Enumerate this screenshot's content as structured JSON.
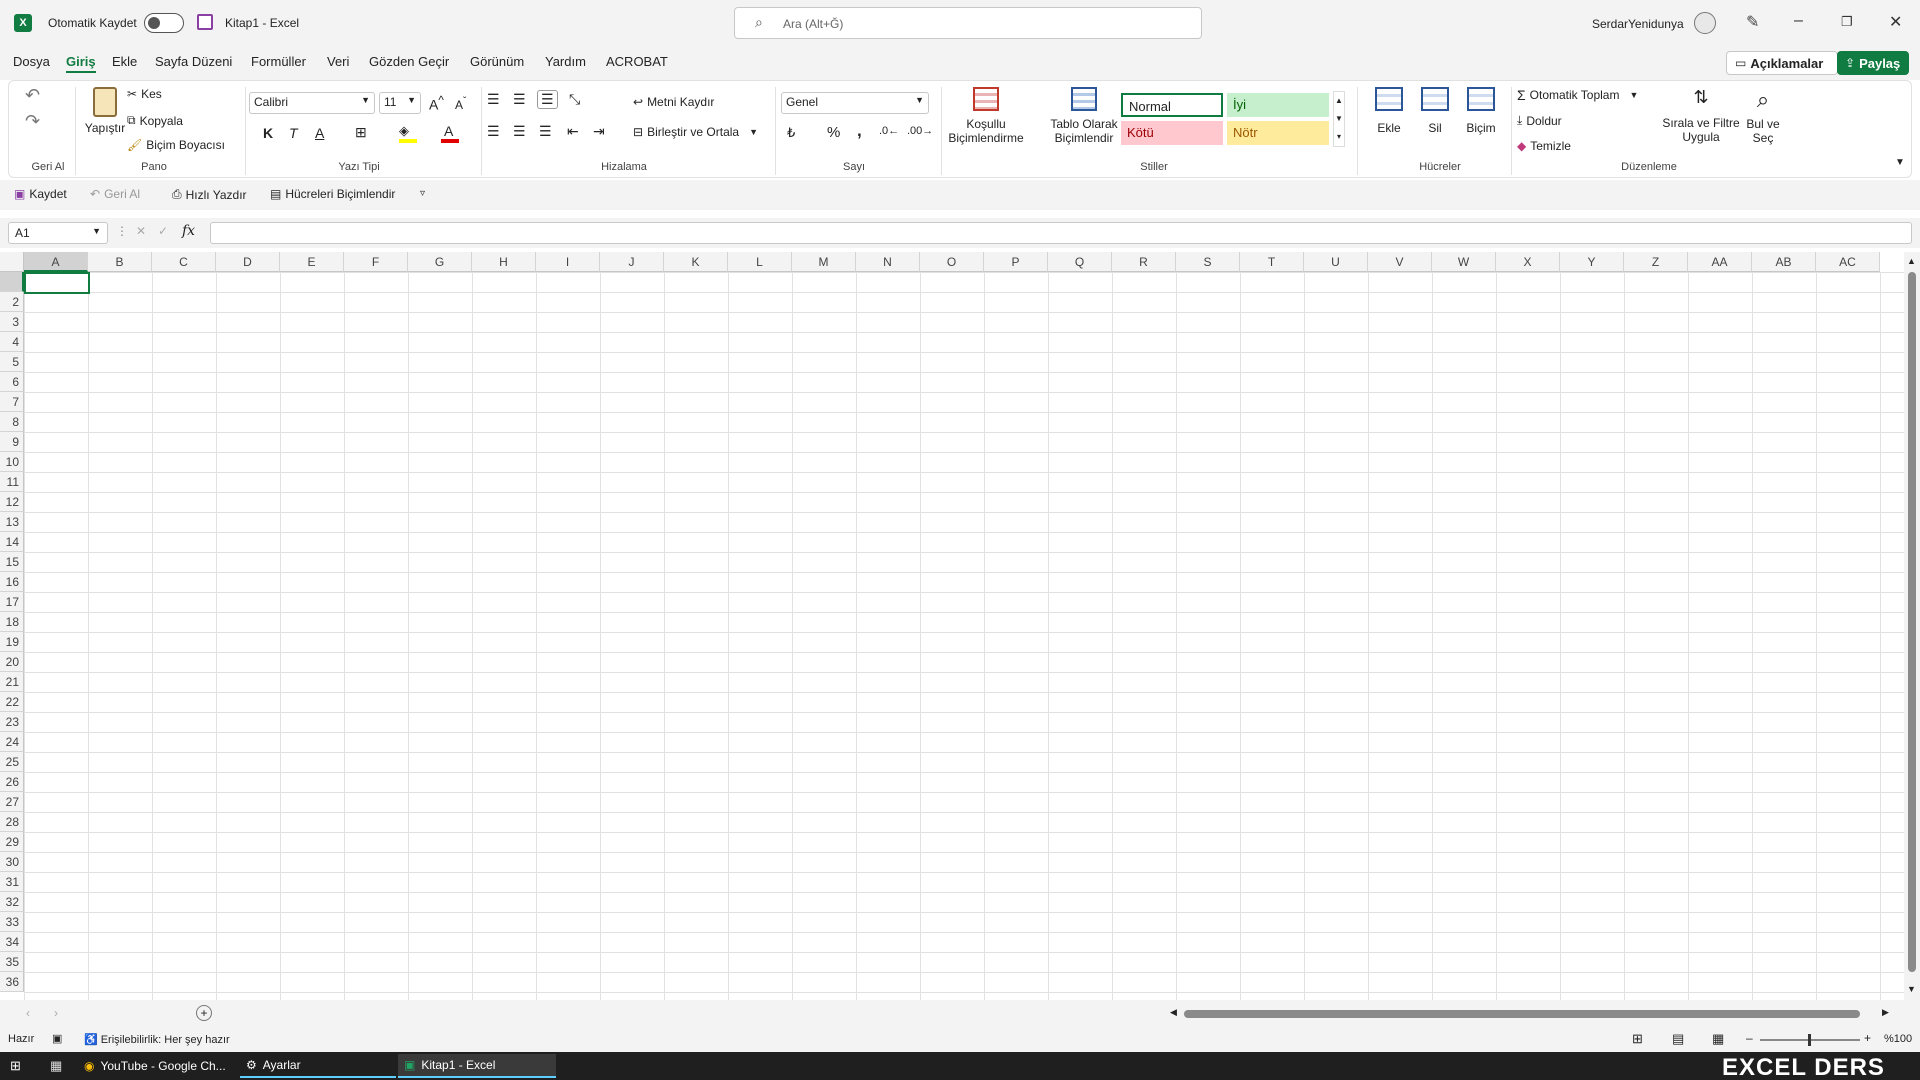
{
  "titlebar": {
    "autosave_label": "Otomatik Kaydet",
    "file_title": "Kitap1  -  Excel",
    "search_placeholder": "Ara (Alt+Ğ)",
    "user_name": "SerdarYenidunya"
  },
  "menu": {
    "items": [
      "Dosya",
      "Giriş",
      "Ekle",
      "Sayfa Düzeni",
      "Formüller",
      "Veri",
      "Gözden Geçir",
      "Görünüm",
      "Yardım",
      "ACROBAT"
    ],
    "active": "Giriş",
    "comments_label": "Açıklamalar",
    "share_label": "Paylaş"
  },
  "ribbon": {
    "undo_group": "Geri Al",
    "clipboard": {
      "group": "Pano",
      "paste": "Yapıştır",
      "cut": "Kes",
      "copy": "Kopyala",
      "format_painter": "Biçim Boyacısı"
    },
    "font": {
      "group": "Yazı Tipi",
      "name": "Calibri",
      "size": "11",
      "bold": "K",
      "italic": "T",
      "underline": "A"
    },
    "alignment": {
      "group": "Hizalama",
      "wrap": "Metni Kaydır",
      "merge": "Birleştir ve Ortala"
    },
    "number": {
      "group": "Sayı",
      "format": "Genel"
    },
    "styles": {
      "group": "Stiller",
      "conditional_1": "Koşullu",
      "conditional_2": "Biçimlendirme",
      "table_1": "Tablo Olarak",
      "table_2": "Biçimlendir",
      "normal": "Normal",
      "good": "İyi",
      "bad": "Kötü",
      "neutral": "Nötr"
    },
    "cells": {
      "group": "Hücreler",
      "insert": "Ekle",
      "delete": "Sil",
      "format": "Biçim"
    },
    "editing": {
      "group": "Düzenleme",
      "autosum": "Otomatik Toplam",
      "fill": "Doldur",
      "clear": "Temizle",
      "sort_1": "Sırala ve Filtre",
      "sort_2": "Uygula",
      "find_1": "Bul ve",
      "find_2": "Seç"
    }
  },
  "qat": {
    "save": "Kaydet",
    "undo": "Geri Al",
    "quick_print": "Hızlı Yazdır",
    "format_cells": "Hücreleri Biçimlendir"
  },
  "formula_bar": {
    "name_box": "A1",
    "fx": "fx",
    "content": ""
  },
  "grid": {
    "columns": [
      "A",
      "B",
      "C",
      "D",
      "E",
      "F",
      "G",
      "H",
      "I",
      "J",
      "K",
      "L",
      "M",
      "N",
      "O",
      "P",
      "Q",
      "R",
      "S",
      "T",
      "U",
      "V",
      "W",
      "X",
      "Y",
      "Z",
      "AA",
      "AB",
      "AC"
    ],
    "rows": [
      "",
      "2",
      "3",
      "4",
      "5",
      "6",
      "7",
      "8",
      "9",
      "10",
      "11",
      "12",
      "13",
      "14",
      "15",
      "16",
      "17",
      "18",
      "19",
      "20",
      "21",
      "22",
      "23",
      "24",
      "25",
      "26",
      "27",
      "28",
      "29",
      "30",
      "31",
      "32",
      "33",
      "34",
      "35",
      "36"
    ]
  },
  "status": {
    "ready": "Hazır",
    "accessibility": "Erişilebilirlik: Her şey hazır",
    "zoom": "%100"
  },
  "taskbar": {
    "items": [
      "YouTube - Google Ch...",
      "Ayarlar",
      "Kitap1 - Excel"
    ],
    "watermark": "EXCEL DERS"
  },
  "colors": {
    "accent": "#107c41",
    "good_bg": "#c6efce",
    "good_fg": "#006100",
    "bad_bg": "#ffc7ce",
    "bad_fg": "#9c0006",
    "neutral_bg": "#ffeb9c",
    "neutral_fg": "#9c5700"
  }
}
